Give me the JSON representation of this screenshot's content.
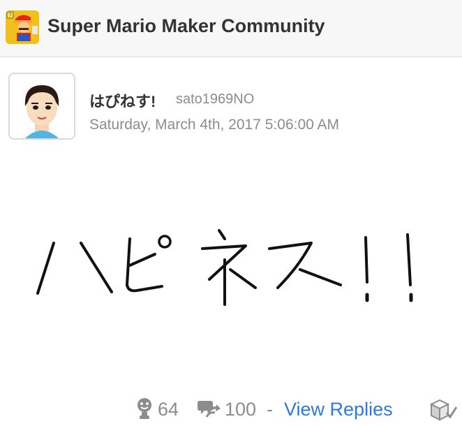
{
  "header": {
    "community_title": "Super Mario Maker Community",
    "community_icon": "mario-maker-icon"
  },
  "post": {
    "username": "はぴねす!",
    "user_id": "sato1969NO",
    "timestamp": "Saturday, March 4th, 2017 5:06:00 AM",
    "avatar": "mii-avatar",
    "drawing_text": "ハピネス!!"
  },
  "footer": {
    "yeah_count": "64",
    "reply_count": "100",
    "separator": "-",
    "view_replies_label": "View Replies",
    "yeah_icon": "yeah-icon",
    "reply_icon": "reply-icon",
    "spoiler_icon": "box-check-icon"
  },
  "colors": {
    "link": "#2a7ae2",
    "muted": "#8c8c8c",
    "text": "#333333",
    "header_bg": "#f7f7f7"
  }
}
